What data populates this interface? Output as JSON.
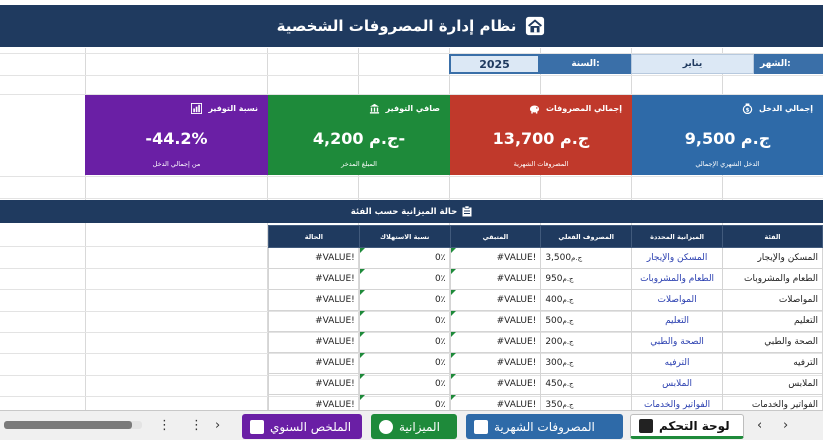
{
  "title": "نظام إدارة المصروفات الشخصية",
  "selectors": {
    "month_label": "الشهر:",
    "month_value": "يناير",
    "year_label": "السنة:",
    "year_value": "2025"
  },
  "cards": [
    {
      "title": "إجمالي الدخل",
      "value": "ج.م 9,500",
      "subtitle": "الدخل الشهري الإجمالي",
      "color": "#2e6aa8",
      "icon": "money-bag-icon"
    },
    {
      "title": "إجمالي المصروفات",
      "value": "ج.م 13,700",
      "subtitle": "المصروفات الشهرية",
      "color": "#c0392b",
      "icon": "piggy-bank-icon"
    },
    {
      "title": "صافي التوفير",
      "value": "ج.م 4,200-",
      "subtitle": "المبلغ المدخر",
      "color": "#1e8a3a",
      "icon": "bank-icon"
    },
    {
      "title": "نسبة التوفير",
      "value": "-44.2%",
      "subtitle": "من إجمالي الدخل",
      "color": "#6a1fa5",
      "icon": "chart-icon"
    }
  ],
  "section_title": "حالة الميزانية حسب الفئة",
  "table": {
    "headers": {
      "status": "الحالة",
      "rate": "نسبة الاستهلاك",
      "remaining": "المتبقي",
      "actual": "المصروف الفعلي",
      "budget": "الميزانية المحددة",
      "category": "الفئة"
    },
    "rows": [
      {
        "status": "#VALUE!",
        "rate": "0٪",
        "remaining": "#VALUE!",
        "currency": "ج.م",
        "actual": "3,500",
        "budget": "المسكن والإيجار",
        "category": "المسكن والإيجار"
      },
      {
        "status": "#VALUE!",
        "rate": "0٪",
        "remaining": "#VALUE!",
        "currency": "ج.م",
        "actual": "950",
        "budget": "الطعام والمشروبات",
        "category": "الطعام والمشروبات"
      },
      {
        "status": "#VALUE!",
        "rate": "0٪",
        "remaining": "#VALUE!",
        "currency": "ج.م",
        "actual": "400",
        "budget": "المواصلات",
        "category": "المواصلات"
      },
      {
        "status": "#VALUE!",
        "rate": "0٪",
        "remaining": "#VALUE!",
        "currency": "ج.م",
        "actual": "500",
        "budget": "التعليم",
        "category": "التعليم"
      },
      {
        "status": "#VALUE!",
        "rate": "0٪",
        "remaining": "#VALUE!",
        "currency": "ج.م",
        "actual": "200",
        "budget": "الصحة والطبي",
        "category": "الصحة والطبي"
      },
      {
        "status": "#VALUE!",
        "rate": "0٪",
        "remaining": "#VALUE!",
        "currency": "ج.م",
        "actual": "300",
        "budget": "الترفيه",
        "category": "الترفيه"
      },
      {
        "status": "#VALUE!",
        "rate": "0٪",
        "remaining": "#VALUE!",
        "currency": "ج.م",
        "actual": "450",
        "budget": "الملابس",
        "category": "الملابس"
      },
      {
        "status": "#VALUE!",
        "rate": "0٪",
        "remaining": "#VALUE!",
        "currency": "ج.م",
        "actual": "350",
        "budget": "الفواتير والخدمات",
        "category": "الفواتير والخدمات"
      }
    ]
  },
  "tabs": [
    {
      "label": "لوحة التحكم",
      "active": true,
      "color": "#ffffff"
    },
    {
      "label": "المصروفات الشهرية",
      "active": false,
      "color": "#2e6aa8"
    },
    {
      "label": "الميزانية",
      "active": false,
      "color": "#1e8a3a"
    },
    {
      "label": "الملخص السنوي",
      "active": false,
      "color": "#6a1fa5"
    }
  ],
  "nav": {
    "prev": "‹",
    "next": "›",
    "more": "⋮",
    "more2": "⋮"
  }
}
